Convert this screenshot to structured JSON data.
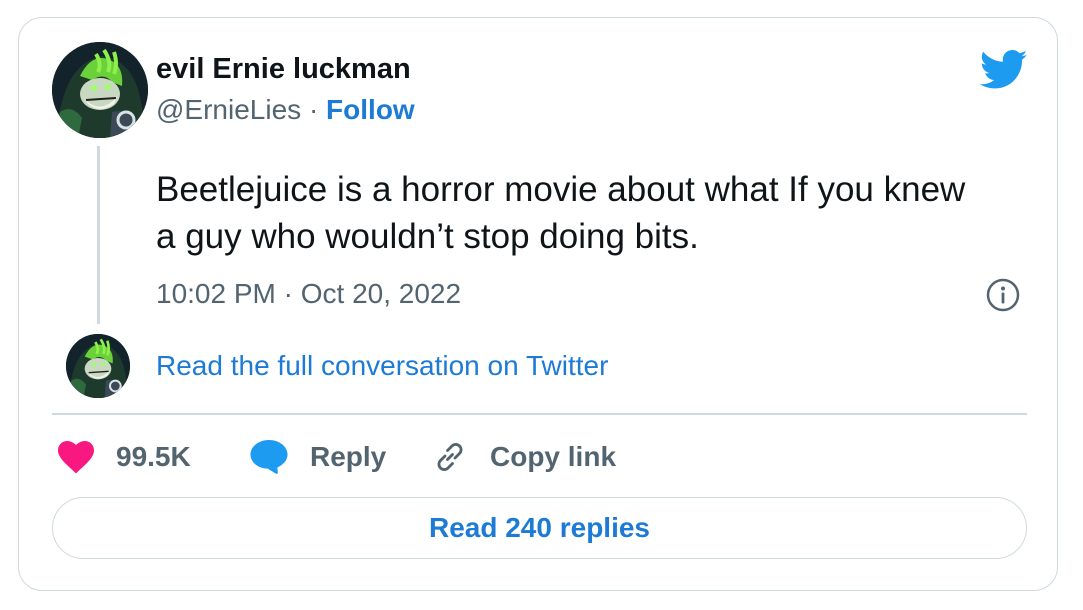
{
  "author": {
    "name": "evil Ernie luckman",
    "handle": "@ErnieLies",
    "separator": "·",
    "follow_label": "Follow"
  },
  "tweet": {
    "text": "Beetlejuice is a horror movie about what If you knew a guy who wouldn’t stop doing bits.",
    "timestamp": "10:02 PM · Oct 20, 2022"
  },
  "conversation_link": "Read the full conversation on Twitter",
  "actions": {
    "likes": "99.5K",
    "reply_label": "Reply",
    "copy_link_label": "Copy link"
  },
  "replies_button": "Read 240 replies",
  "icons": {
    "brand": "twitter-bird-icon",
    "info": "info-icon",
    "like": "heart-icon",
    "reply": "speech-bubble-icon",
    "copy": "link-icon"
  },
  "colors": {
    "brand_blue": "#1d9bf0",
    "link_blue": "#1d7bd6",
    "heart_pink": "#f91880",
    "muted_text": "#536471",
    "border": "#cfd9de"
  }
}
